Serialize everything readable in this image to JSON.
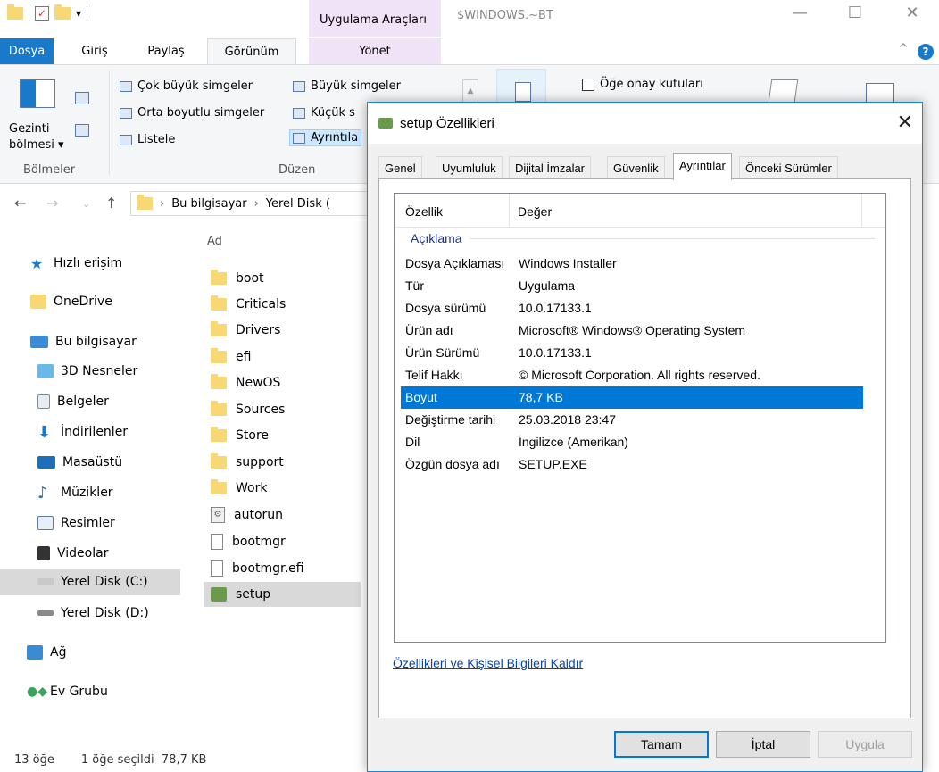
{
  "explorer": {
    "window_title": "$WINDOWS.~BT",
    "context_tab_header": "Uygulama Araçları",
    "ribbon_tabs": [
      "Dosya",
      "Giriş",
      "Paylaş",
      "Görünüm",
      "Yönet"
    ],
    "panes_group": {
      "nav_pane_label_1": "Gezinti",
      "nav_pane_label_2": "bölmesi ▾",
      "label": "Bölmeler"
    },
    "layout_group": {
      "items": [
        "Çok büyük simgeler",
        "Büyük simgeler",
        "Orta boyutlu simgeler",
        "Küçük s",
        "Listele",
        "Ayrıntıla"
      ],
      "label": "Düzen"
    },
    "show_hide": {
      "item_checkboxes": "Öğe onay kutuları"
    },
    "address": {
      "crumbs": [
        "Bu bilgisayar",
        "Yerel Disk ("
      ]
    },
    "nav_pane": [
      {
        "label": "Hızlı erişim",
        "icon": "star-icon"
      },
      {
        "label": "OneDrive",
        "icon": "folder-icon"
      },
      {
        "label": "Bu bilgisayar",
        "icon": "computer-icon"
      },
      {
        "label": "3D Nesneler",
        "icon": "cube-icon"
      },
      {
        "label": "Belgeler",
        "icon": "document-icon"
      },
      {
        "label": "İndirilenler",
        "icon": "download-icon"
      },
      {
        "label": "Masaüstü",
        "icon": "desktop-icon"
      },
      {
        "label": "Müzikler",
        "icon": "music-icon"
      },
      {
        "label": "Resimler",
        "icon": "pictures-icon"
      },
      {
        "label": "Videolar",
        "icon": "video-icon"
      },
      {
        "label": "Yerel Disk (C:)",
        "icon": "drive-icon"
      },
      {
        "label": "Yerel Disk (D:)",
        "icon": "drive-icon"
      },
      {
        "label": "Ağ",
        "icon": "network-icon"
      },
      {
        "label": "Ev Grubu",
        "icon": "homegroup-icon"
      }
    ],
    "file_list": {
      "column_header": "Ad",
      "files": [
        "boot",
        "Criticals",
        "Drivers",
        "efi",
        "NewOS",
        "Sources",
        "Store",
        "support",
        "Work",
        "autorun",
        "bootmgr",
        "bootmgr.efi",
        "setup"
      ]
    },
    "status": {
      "count": "13 öğe",
      "selection": "1 öğe seçildi  78,7 KB"
    }
  },
  "dialog": {
    "title": "setup Özellikleri",
    "tabs": [
      "Genel",
      "Uyumluluk",
      "Dijital İmzalar",
      "Güvenlik",
      "Ayrıntılar",
      "Önceki Sürümler"
    ],
    "active_tab": "Ayrıntılar",
    "columns": {
      "property": "Özellik",
      "value": "Değer"
    },
    "group_label": "Açıklama",
    "properties": [
      {
        "k": "Dosya Açıklaması",
        "v": "Windows Installer"
      },
      {
        "k": "Tür",
        "v": "Uygulama"
      },
      {
        "k": "Dosya sürümü",
        "v": "10.0.17133.1"
      },
      {
        "k": "Ürün adı",
        "v": "Microsoft® Windows® Operating System"
      },
      {
        "k": "Ürün Sürümü",
        "v": "10.0.17133.1"
      },
      {
        "k": "Telif Hakkı",
        "v": "© Microsoft Corporation. All rights reserved."
      },
      {
        "k": "Boyut",
        "v": "78,7 KB"
      },
      {
        "k": "Değiştirme tarihi",
        "v": "25.03.2018 23:47"
      },
      {
        "k": "Dil",
        "v": "İngilizce (Amerikan)"
      },
      {
        "k": "Özgün dosya adı",
        "v": "SETUP.EXE"
      }
    ],
    "selected_property": "Boyut",
    "remove_link": "Özellikleri ve Kişisel Bilgileri Kaldır",
    "buttons": {
      "ok": "Tamam",
      "cancel": "İptal",
      "apply": "Uygula"
    }
  },
  "colors": {
    "accent": "#0078d7",
    "file_tab": "#1979ca",
    "context_tab": "#f1e3f7"
  }
}
